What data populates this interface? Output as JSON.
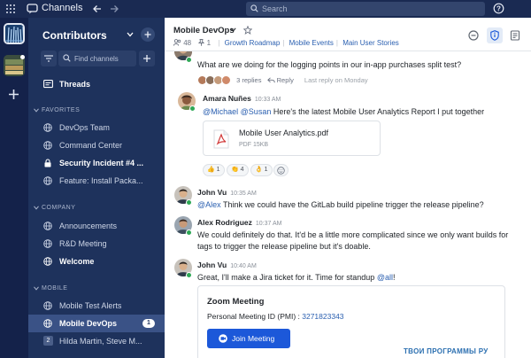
{
  "app": {
    "title": "Channels"
  },
  "search": {
    "placeholder": "Search"
  },
  "sidebar": {
    "team_name": "Contributors",
    "find_placeholder": "Find channels",
    "threads": "Threads",
    "favorites": {
      "header": "FAVORITES",
      "items": [
        "DevOps Team",
        "Command Center",
        "Security Incident #4 ...",
        "Feature: Install Packa..."
      ]
    },
    "company": {
      "header": "COMPANY",
      "items": [
        "Announcements",
        "R&D Meeting",
        "Welcome"
      ]
    },
    "mobile": {
      "header": "MOBILE",
      "items": [
        "Mobile Test Alerts",
        "Mobile DevOps",
        "Hilda Martin, Steve M..."
      ],
      "active_badge": "1"
    }
  },
  "channel": {
    "name": "Mobile DevOps",
    "members": "48",
    "pinned": "1",
    "bookmarks": [
      "Growth Roadmap",
      "Mobile Events",
      "Main User Stories"
    ]
  },
  "messages": [
    {
      "text": "What are we doing for the logging points in our in-app purchases split test?",
      "thread": {
        "replies": "3 replies",
        "reply_label": "Reply",
        "last_reply": "Last reply on Monday"
      }
    },
    {
      "author": "Amara Nuñes",
      "time": "10:33 AM",
      "mention1": "@Michael",
      "mention2": "@Susan",
      "text": "Here's the latest Mobile User Analytics Report I put together",
      "file": {
        "name": "Mobile User Analytics.pdf",
        "meta": "PDF 15KB"
      },
      "reactions": [
        "1",
        "4",
        "1"
      ]
    },
    {
      "author": "John Vu",
      "time": "10:35 AM",
      "mention": "@Alex",
      "text": "Think we could have the GitLab build pipeline trigger the release pipeline?"
    },
    {
      "author": "Alex Rodriguez",
      "time": "10:37 AM",
      "line1": "We could definitely do that. It'd be a little more complicated since we only want builds for",
      "line2": "tags to trigger the release pipeline but it's doable."
    },
    {
      "author": "John Vu",
      "time": "10:40 AM",
      "text": "Great, I'll make a Jira ticket for it. Time for standup",
      "mention": "@all",
      "end": "!",
      "zoom": {
        "title": "Zoom Meeting",
        "id_label": "Personal Meeting ID (PMI) :",
        "id_value": "3271823343",
        "button": "Join Meeting"
      }
    }
  ],
  "watermark": "ТВОИ ПРОГРАММЫ РУ",
  "colors": {
    "sidebar": "#1e325c",
    "topbar": "#1a2a52",
    "accent": "#2a5fb0",
    "online": "#2ea856",
    "button": "#1c58d9"
  }
}
